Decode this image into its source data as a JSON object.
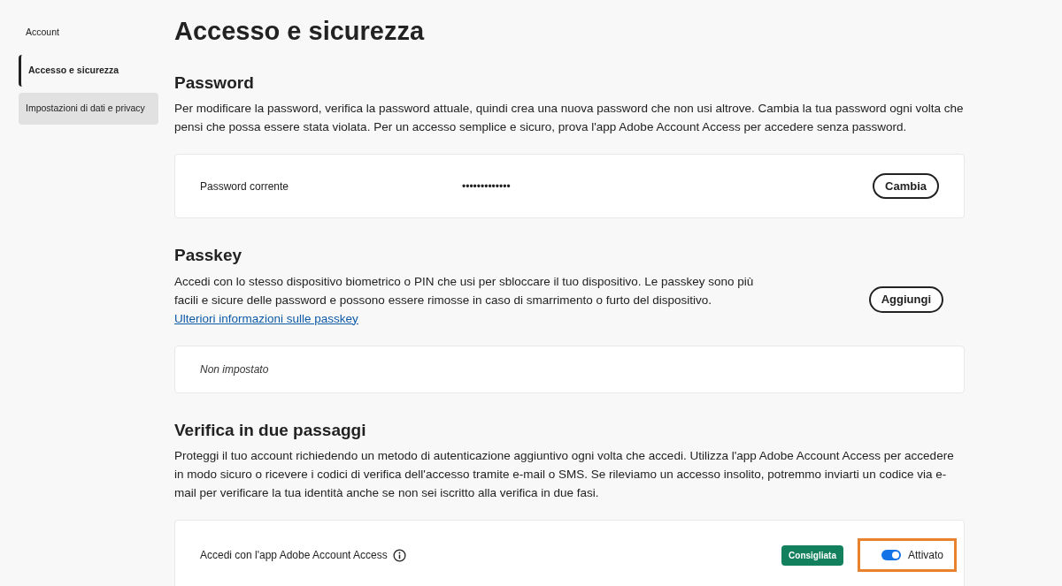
{
  "sidebar": {
    "items": [
      {
        "label": "Account",
        "selected": false,
        "hovered": false
      },
      {
        "label": "Accesso e sicurezza",
        "selected": true,
        "hovered": false
      },
      {
        "label": "Impostazioni di dati e privacy",
        "selected": false,
        "hovered": true
      }
    ]
  },
  "title": "Accesso e sicurezza",
  "sections": [
    {
      "kind": "password",
      "heading": "Password",
      "text": "Per modificare la password, verifica la password attuale, quindi crea una nuova password che non usi altrove. Cambia la tua password ogni volta che pensi che possa essere stata violata. Per un accesso semplice e sicuro, prova l'app Adobe Account Access per accedere senza password.",
      "card": {
        "label": "Password corrente",
        "value": "•••••••••••••",
        "button": "Cambia"
      }
    },
    {
      "kind": "passkey",
      "heading": "Passkey",
      "text": "Accedi con lo stesso dispositivo biometrico o PIN che usi per sbloccare il tuo dispositivo. Le passkey sono più facili e sicure delle password e possono essere rimosse in caso di smarrimento o furto del dispositivo.",
      "link": "Ulteriori informazioni sulle passkey",
      "button": "Aggiungi",
      "card": {
        "status": "Non impostato"
      }
    },
    {
      "kind": "twofactor",
      "heading": "Verifica in due passaggi",
      "text": "Proteggi il tuo account richiedendo un metodo di autenticazione aggiuntivo ogni volta che accedi. Utilizza l'app Adobe Account Access per accedere in modo sicuro o ricevere i codici di verifica dell'accesso tramite e-mail o SMS. Se rileviamo un accesso insolito, potremmo inviarti un codice via e-mail per verificare la tua identità anche se non sei iscritto alla verifica in due fasi.",
      "card": {
        "label": "Accedi con l'app Adobe Account Access",
        "badge": "Consigliata",
        "toggle": {
          "on": true,
          "label": "Attivato",
          "highlighted": true
        }
      }
    }
  ]
}
